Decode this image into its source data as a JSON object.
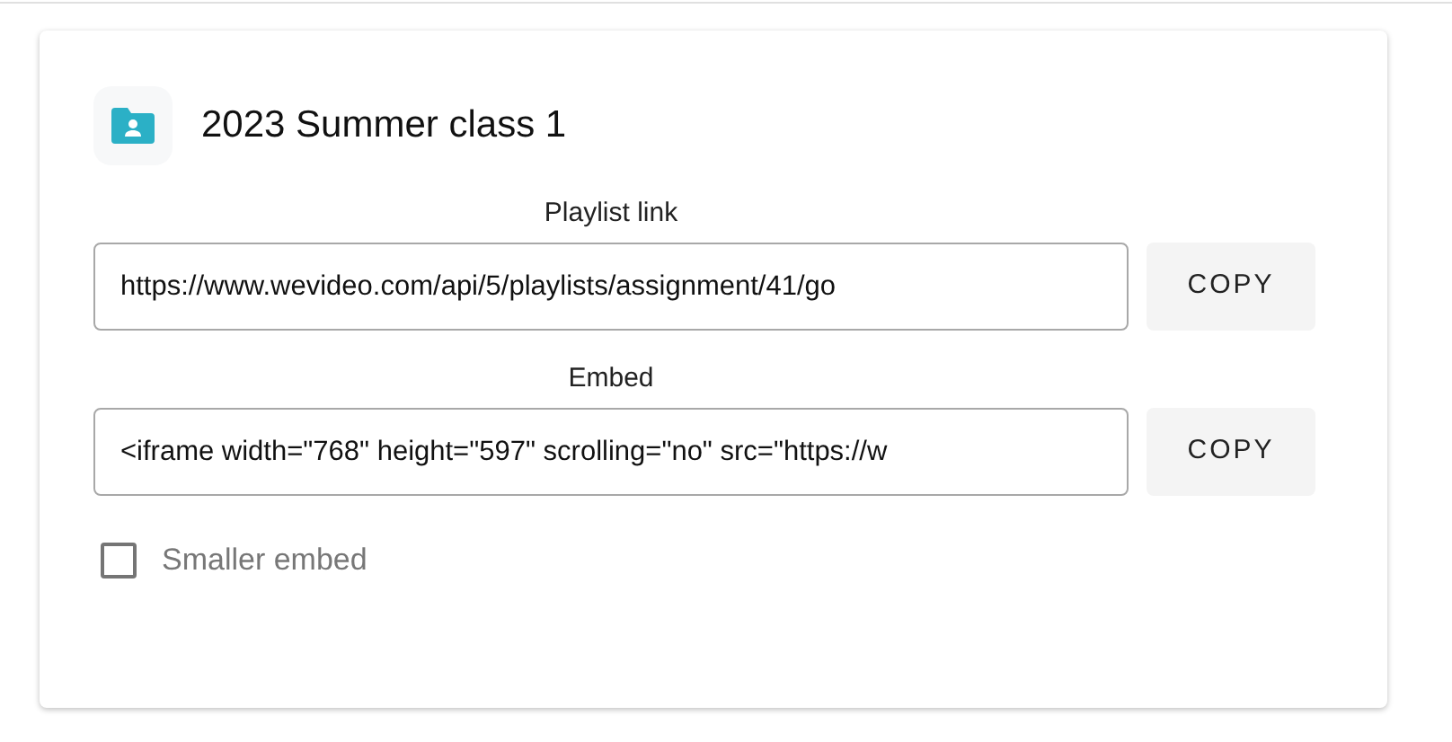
{
  "card": {
    "title": "2023 Summer class 1",
    "fields": [
      {
        "label": "Playlist link",
        "value": "https://www.wevideo.com/api/5/playlists/assignment/41/go",
        "button": "COPY"
      },
      {
        "label": "Embed",
        "value": "<iframe width=\"768\" height=\"597\" scrolling=\"no\" src=\"https://w",
        "button": "COPY"
      }
    ],
    "option": {
      "label": "Smaller embed",
      "checked": false
    }
  }
}
